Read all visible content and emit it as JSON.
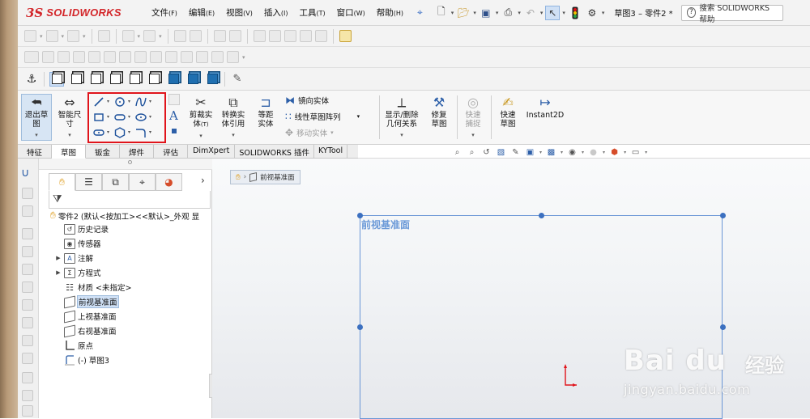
{
  "app": {
    "logo_ds": "3S",
    "logo_text": "SOLIDWORKS",
    "brand_color": "#d3262a"
  },
  "menu": [
    {
      "label": "文件",
      "key": "(F)"
    },
    {
      "label": "编辑",
      "key": "(E)"
    },
    {
      "label": "视图",
      "key": "(V)"
    },
    {
      "label": "插入",
      "key": "(I)"
    },
    {
      "label": "工具",
      "key": "(T)"
    },
    {
      "label": "窗口",
      "key": "(W)"
    },
    {
      "label": "帮助",
      "key": "(H)"
    }
  ],
  "title": {
    "document": "草图3 – 零件2 *",
    "search_placeholder": "搜索 SOLIDWORKS 帮助"
  },
  "command_manager": {
    "exit_sketch": "退出草图",
    "smart_dimension": "智能尺寸",
    "trim": "剪裁实体",
    "trim_suffix": "(T)",
    "convert": "转换实体引用",
    "offset": "等距实体",
    "mirror": "镜向实体",
    "linear_pattern": "线性草图阵列",
    "move": "移动实体",
    "display_relations": "显示/删除几何关系",
    "repair_sketch": "修复草图",
    "quick_snaps": "快速捕捉",
    "rapid_sketch": "快速草图",
    "instant2d": "Instant2D"
  },
  "tabs": [
    "特征",
    "草图",
    "钣金",
    "焊件",
    "评估",
    "DimXpert",
    "SOLIDWORKS 插件",
    "KYTool"
  ],
  "active_tab": "草图",
  "feature_tree": {
    "root": "零件2 (默认<按加工><<默认>_外观 显",
    "items": [
      {
        "label": "历史记录",
        "icon": "history-icon",
        "expandable": false
      },
      {
        "label": "传感器",
        "icon": "sensor-icon",
        "expandable": false
      },
      {
        "label": "注解",
        "icon": "annotations-icon",
        "expandable": true
      },
      {
        "label": "方程式",
        "icon": "equations-icon",
        "expandable": true
      },
      {
        "label": "材质 <未指定>",
        "icon": "material-icon",
        "expandable": false
      },
      {
        "label": "前视基准面",
        "icon": "plane-icon",
        "expandable": false,
        "selected": true
      },
      {
        "label": "上视基准面",
        "icon": "plane-icon",
        "expandable": false
      },
      {
        "label": "右视基准面",
        "icon": "plane-icon",
        "expandable": false
      },
      {
        "label": "原点",
        "icon": "origin-icon",
        "expandable": false
      },
      {
        "label": "(-) 草图3",
        "icon": "sketch-icon",
        "expandable": false
      }
    ]
  },
  "graphics": {
    "breadcrumb": "前视基准面",
    "plane_label": "前视基准面",
    "plane_color": "#6a96d6",
    "origin_color": "#e0141b"
  },
  "watermark": {
    "logo": "Bai du",
    "cn": "经验",
    "url": "jingyan.baidu.com"
  },
  "highlight_color": "#e0141b"
}
